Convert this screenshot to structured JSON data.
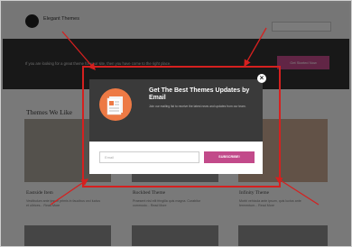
{
  "site": {
    "name": "Elegant Themes",
    "search_placeholder": "",
    "hero_text": "If you are looking for a great theme for your site, then you have come to the right place.",
    "hero_cta": "Get Started Now"
  },
  "section": {
    "title": "Themes We Like"
  },
  "cards": [
    {
      "title": "Eastside Item",
      "desc": "Vestibulum ante ipsum primis in faucibus orci luctus et ultrices... Read More"
    },
    {
      "title": "Rockbed Theme",
      "desc": "Praesent nisl elit fringilla quis magna. Curabitur commodo... Read More"
    },
    {
      "title": "Infinity Theme",
      "desc": "Morbi vehicula ante ipsum, quis luctus ante fermentum... Read More"
    }
  ],
  "popup": {
    "title": "Get The Best Themes Updates by Email",
    "subtitle": "Join our mailing list to receive the latest news and updates from our team.",
    "email_placeholder": "Email",
    "button_label": "SUBSCRIBE!",
    "close_symbol": "×"
  },
  "colors": {
    "accent": "#c24a8a",
    "icon_bg": "#ed7a45",
    "annotation_red": "#d5201f",
    "popup_dark": "#3a3a3a"
  }
}
